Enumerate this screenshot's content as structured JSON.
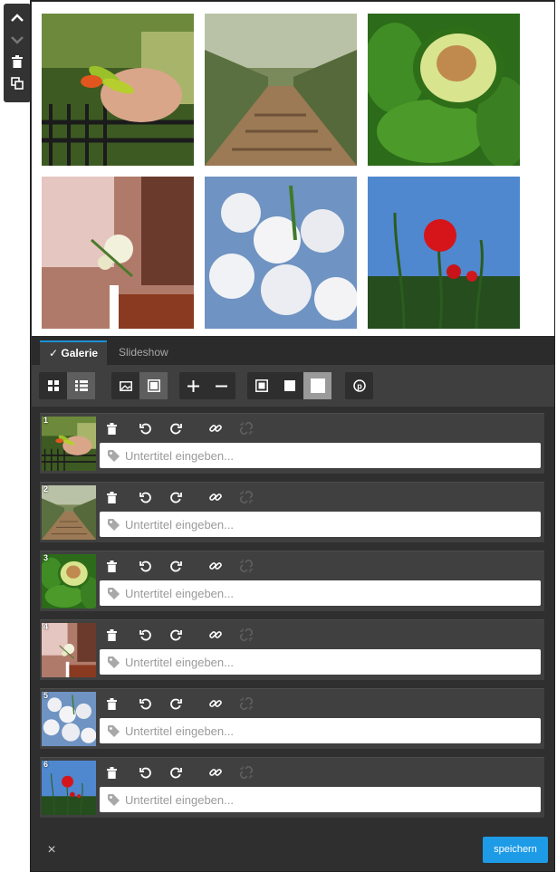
{
  "tabs": {
    "gallery_label": "Galerie",
    "slideshow_label": "Slideshow"
  },
  "preview": {
    "images": [
      {
        "subject": "hand holding peppers"
      },
      {
        "subject": "olive grove path"
      },
      {
        "subject": "avocado halves"
      },
      {
        "subject": "white flower bouquet"
      },
      {
        "subject": "white blossoms"
      },
      {
        "subject": "red poppies"
      }
    ]
  },
  "list": {
    "caption_placeholder": "Untertitel eingeben...",
    "items": [
      {
        "number": "1"
      },
      {
        "number": "2"
      },
      {
        "number": "3"
      },
      {
        "number": "4"
      },
      {
        "number": "5"
      },
      {
        "number": "6"
      }
    ]
  },
  "footer": {
    "close_label": "×",
    "save_label": "speichern"
  },
  "colors": {
    "accent": "#1d9be6",
    "panel": "#2f2f2f",
    "row": "#404040"
  }
}
